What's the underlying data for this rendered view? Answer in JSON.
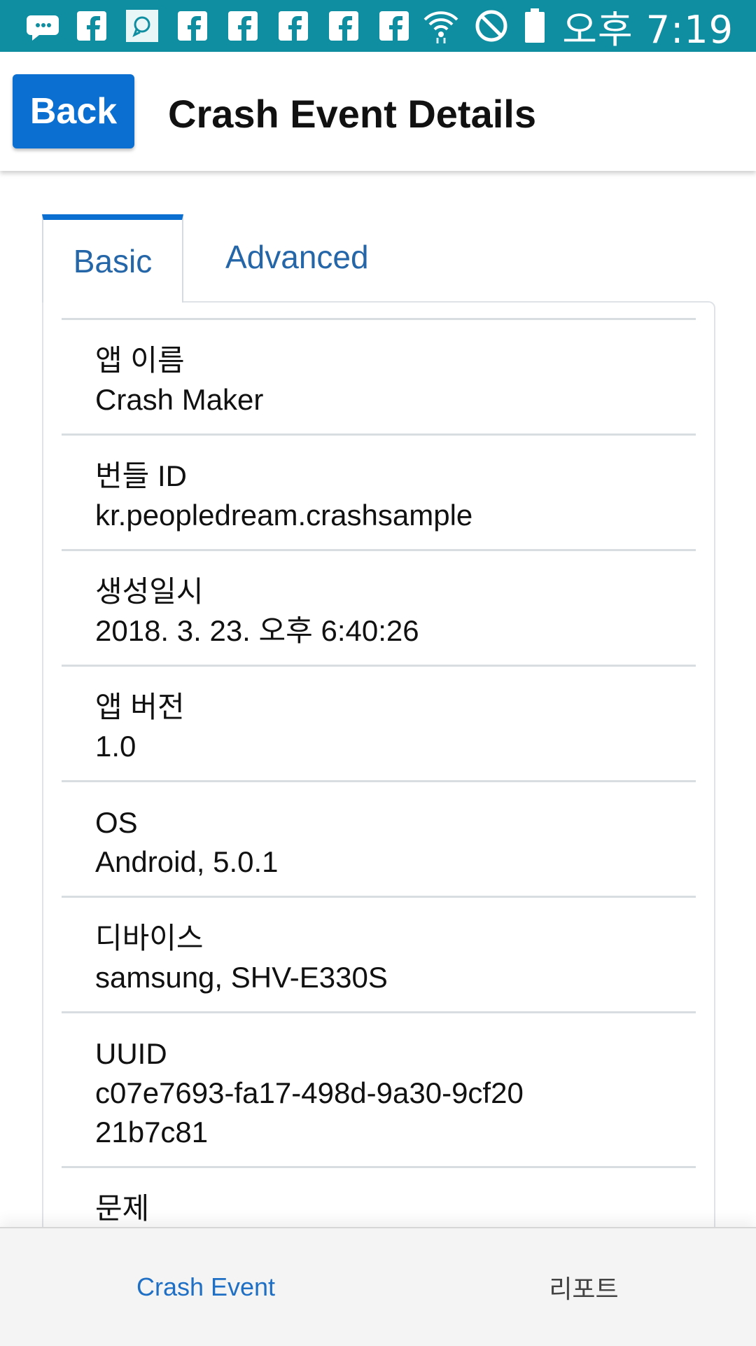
{
  "status_bar": {
    "time": "오후 7:19",
    "icons": [
      "messenger-icon",
      "facebook-icon",
      "chat-icon",
      "facebook-icon",
      "facebook-icon",
      "facebook-icon",
      "facebook-icon",
      "facebook-icon",
      "wifi-icon",
      "do-not-disturb-icon",
      "battery-icon"
    ],
    "background": "#0f8ea1"
  },
  "header": {
    "back_label": "Back",
    "title": "Crash Event Details",
    "accent_color": "#0a6fd1"
  },
  "tabs": {
    "basic": "Basic",
    "advanced": "Advanced",
    "selected": "Basic"
  },
  "details": [
    {
      "label": "앱 이름",
      "value": "Crash Maker"
    },
    {
      "label": "번들 ID",
      "value": "kr.peopledream.crashsample"
    },
    {
      "label": "생성일시",
      "value": "2018. 3. 23. 오후 6:40:26"
    },
    {
      "label": "앱 버전",
      "value": "1.0"
    },
    {
      "label": "OS",
      "value": "Android, 5.0.1"
    },
    {
      "label": "디바이스",
      "value": "samsung, SHV-E330S"
    },
    {
      "label": "UUID",
      "value": "c07e7693-fa17-498d-9a30-9cf2021b7c81"
    },
    {
      "label": "문제",
      "value": ""
    }
  ],
  "bottom_nav": {
    "crash_event": "Crash Event",
    "report": "리포트",
    "selected": "Crash Event"
  }
}
